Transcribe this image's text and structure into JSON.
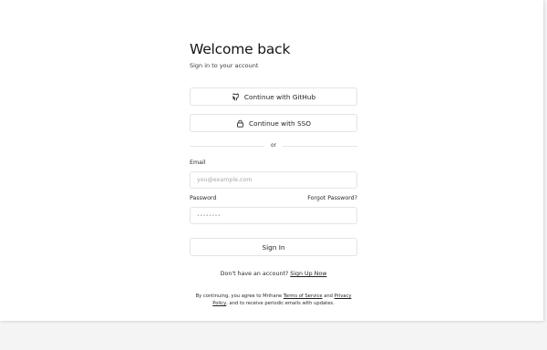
{
  "header": {
    "title": "Welcome back",
    "subtitle": "Sign in to your account"
  },
  "oauth": {
    "github_label": "Continue with GitHub",
    "github_icon": "github-icon",
    "sso_label": "Continue with SSO",
    "sso_icon": "lock-icon"
  },
  "divider_text": "or",
  "form": {
    "email_label": "Email",
    "email_placeholder": "you@example.com",
    "email_value": "",
    "password_label": "Password",
    "password_placeholder": "••••••••",
    "password_value": "",
    "forgot_label": "Forgot Password?",
    "submit_label": "Sign In"
  },
  "signup": {
    "prompt": "Don't have an account?",
    "link": "Sign Up Now"
  },
  "legal": {
    "prefix": "By continuing, you agree to Mrihane",
    "terms": "Terms of Service",
    "and": "and",
    "privacy": "Privacy Policy",
    "suffix": ", and to receive periodic emails with updates."
  }
}
